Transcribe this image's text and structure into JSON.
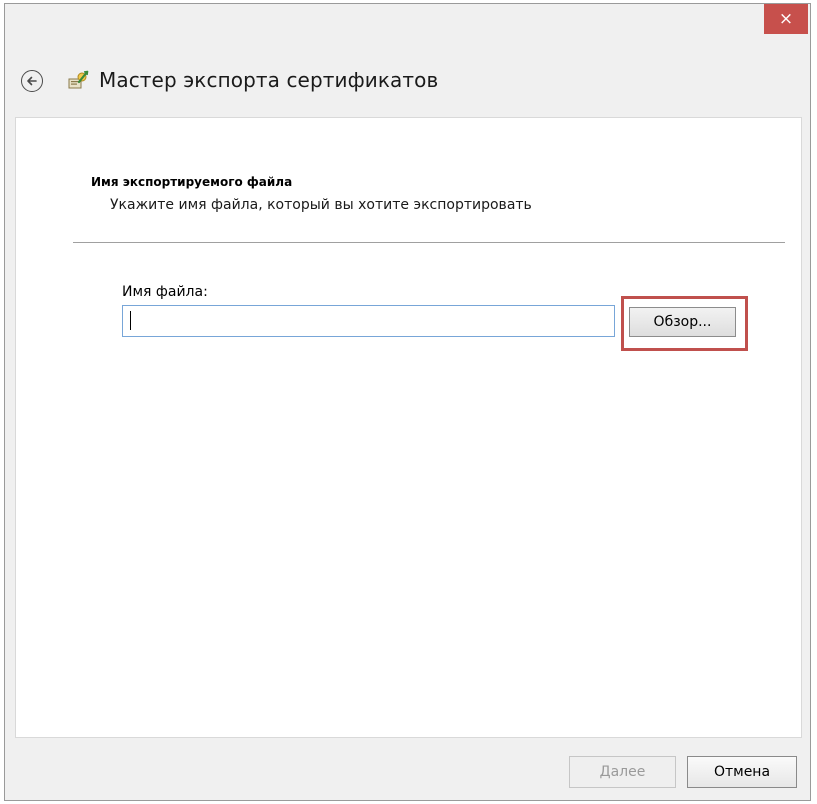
{
  "window": {
    "title": "Мастер экспорта сертификатов",
    "close_label": "×"
  },
  "icons": {
    "back": "back-arrow-icon",
    "wizard": "certificate-wizard-icon"
  },
  "page": {
    "heading": "Имя экспортируемого файла",
    "subheading": "Укажите имя файла, который вы хотите экспортировать"
  },
  "file": {
    "label": "Имя файла:",
    "value": "",
    "browse_label": "Обзор..."
  },
  "footer": {
    "next_label": "Далее",
    "cancel_label": "Отмена"
  },
  "colors": {
    "close_button": "#c7504c",
    "highlight": "#c0504d",
    "input_border": "#78a6d8"
  }
}
